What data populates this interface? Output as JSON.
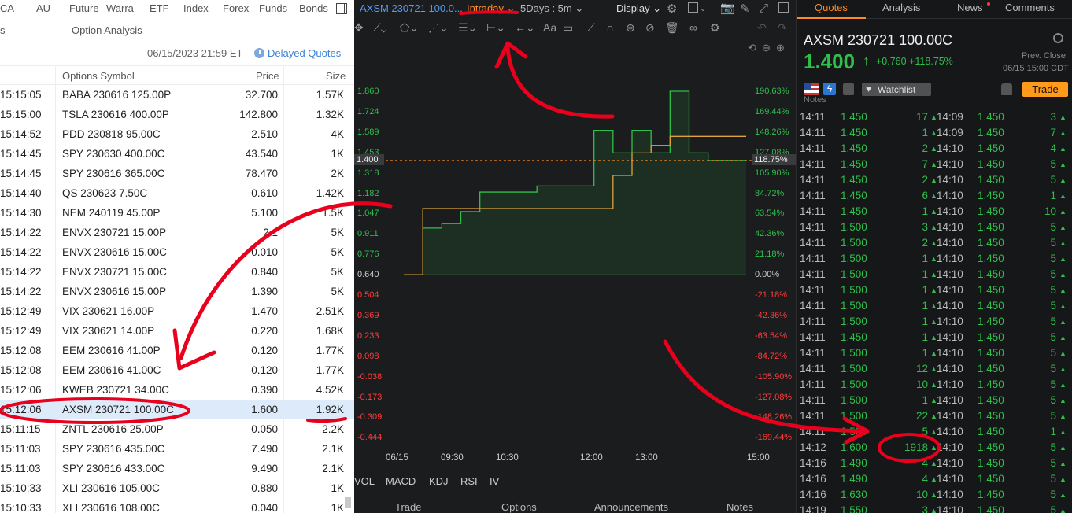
{
  "left": {
    "market_tabs": [
      "CA",
      "AU",
      "Future",
      "Warra",
      "ETF",
      "Index",
      "Forex",
      "Funds",
      "Bonds"
    ],
    "subtabs": [
      "s",
      "Option Analysis"
    ],
    "datetime": "06/15/2023 21:59 ET",
    "delayed": "Delayed Quotes",
    "columns": {
      "symbol": "Options Symbol",
      "price": "Price",
      "size": "Size"
    },
    "rows": [
      {
        "time": "15:15:05",
        "symbol": "BABA 230616 125.00P",
        "price": "32.700",
        "size": "1.57K"
      },
      {
        "time": "15:15:00",
        "symbol": "TSLA 230616 400.00P",
        "price": "142.800",
        "size": "1.32K"
      },
      {
        "time": "15:14:52",
        "symbol": "PDD 230818 95.00C",
        "price": "2.510",
        "size": "4K"
      },
      {
        "time": "15:14:45",
        "symbol": "SPY 230630 400.00C",
        "price": "43.540",
        "size": "1K"
      },
      {
        "time": "15:14:45",
        "symbol": "SPY 230616 365.00C",
        "price": "78.470",
        "size": "2K"
      },
      {
        "time": "15:14:40",
        "symbol": "QS 230623 7.50C",
        "price": "0.610",
        "size": "1.42K"
      },
      {
        "time": "15:14:30",
        "symbol": "NEM 240119 45.00P",
        "price": "5.100",
        "size": "1.5K"
      },
      {
        "time": "15:14:22",
        "symbol": "ENVX 230721 15.00P",
        "price": "2.1",
        "size": "5K"
      },
      {
        "time": "15:14:22",
        "symbol": "ENVX 230616 15.00C",
        "price": "0.010",
        "size": "5K"
      },
      {
        "time": "15:14:22",
        "symbol": "ENVX 230721 15.00C",
        "price": "0.840",
        "size": "5K"
      },
      {
        "time": "15:14:22",
        "symbol": "ENVX 230616 15.00P",
        "price": "1.390",
        "size": "5K"
      },
      {
        "time": "15:12:49",
        "symbol": "VIX 230621 16.00P",
        "price": "1.470",
        "size": "2.51K"
      },
      {
        "time": "15:12:49",
        "symbol": "VIX 230621 14.00P",
        "price": "0.220",
        "size": "1.68K"
      },
      {
        "time": "15:12:08",
        "symbol": "EEM 230616 41.00P",
        "price": "0.120",
        "size": "1.77K"
      },
      {
        "time": "15:12:08",
        "symbol": "EEM 230616 41.00C",
        "price": "0.120",
        "size": "1.77K"
      },
      {
        "time": "15:12:06",
        "symbol": "KWEB 230721 34.00C",
        "price": "0.390",
        "size": "4.52K"
      },
      {
        "time": "15:12:06",
        "symbol": "AXSM 230721 100.00C",
        "price": "1.600",
        "size": "1.92K"
      },
      {
        "time": "15:11:15",
        "symbol": "ZNTL 230616 25.00P",
        "price": "0.050",
        "size": "2.2K"
      },
      {
        "time": "15:11:03",
        "symbol": "SPY 230616 435.00C",
        "price": "7.490",
        "size": "2.1K"
      },
      {
        "time": "15:11:03",
        "symbol": "SPY 230616 433.00C",
        "price": "9.490",
        "size": "2.1K"
      },
      {
        "time": "15:10:33",
        "symbol": "XLI 230616 105.00C",
        "price": "0.880",
        "size": "1K"
      },
      {
        "time": "15:10:33",
        "symbol": "XLI 230616 108.00C",
        "price": "0.040",
        "size": "1K"
      }
    ],
    "selected_index": 16
  },
  "mid": {
    "title": "AXSM 230721 100.0...",
    "period": "Intraday",
    "interval": "5Days : 5m",
    "display": "Display",
    "indicators": [
      "VOL",
      "MACD",
      "KDJ",
      "RSI",
      "IV"
    ],
    "bottom_tabs": [
      "Trade",
      "Options",
      "Announcements",
      "Notes"
    ],
    "price_axis": [
      "1.860",
      "1.724",
      "1.589",
      "1.453",
      "1.318",
      "1.182",
      "1.047",
      "0.911",
      "0.776",
      "0.640",
      "0.504",
      "0.369",
      "0.233",
      "0.098",
      "-0.038",
      "-0.173",
      "-0.309",
      "-0.444"
    ],
    "pct_axis": [
      "190.63%",
      "169.44%",
      "148.26%",
      "127.08%",
      "105.90%",
      "84.72%",
      "63.54%",
      "42.36%",
      "21.18%",
      "0.00%",
      "-21.18%",
      "-42.36%",
      "-63.54%",
      "-84.72%",
      "-105.90%",
      "-127.08%",
      "-148.26%",
      "-169.44%"
    ],
    "current_price_tag": "1.400",
    "current_pct_tag": "118.75%",
    "time_labels": [
      "06/15",
      "09:30",
      "10:30",
      "12:00",
      "13:00",
      "15:00"
    ]
  },
  "chart_data": {
    "type": "line",
    "title": "",
    "xlabel": "",
    "ylabel": "",
    "x": [
      "06/15 09:30",
      "09:40",
      "09:50",
      "10:05",
      "10:30",
      "11:10",
      "11:45",
      "11:50",
      "12:30",
      "13:10",
      "14:05",
      "14:10",
      "14:12",
      "14:16",
      "14:20",
      "14:30",
      "14:40",
      "14:50",
      "15:00"
    ],
    "series": [
      {
        "values": [
          0.64,
          0.95,
          0.98,
          1.06,
          1.19,
          1.19,
          1.19,
          1.23,
          1.23,
          1.23,
          1.6,
          1.45,
          1.6,
          1.45,
          1.86,
          1.45,
          1.4,
          1.4,
          1.4
        ]
      },
      {
        "values": [
          0.64,
          1.08,
          1.08,
          1.08,
          1.08,
          1.08,
          1.08,
          1.08,
          1.08,
          1.08,
          1.08,
          1.3,
          1.45,
          1.5,
          1.56,
          1.56,
          1.56,
          1.56,
          1.56
        ]
      }
    ],
    "ylim": [
      -0.444,
      1.86
    ],
    "reference_price": 0.64,
    "grid": false
  },
  "right": {
    "tabs": [
      "Quotes",
      "Analysis",
      "News",
      "Comments"
    ],
    "symbol": "AXSM 230721 100.00C",
    "price": "1.400",
    "arrow": "↑",
    "change": "+0.760 +118.75%",
    "prev_label": "Prev.  Close",
    "prev_datetime": "06/15 15:00 CDT",
    "watchlist": "Watchlist",
    "trade": "Trade",
    "notes_label": "Notes",
    "ticks": [
      [
        "14:11",
        "1.450",
        "17",
        "14:09",
        "1.450",
        "3"
      ],
      [
        "14:11",
        "1.450",
        "1",
        "14:09",
        "1.450",
        "7"
      ],
      [
        "14:11",
        "1.450",
        "2",
        "14:10",
        "1.450",
        "4"
      ],
      [
        "14:11",
        "1.450",
        "7",
        "14:10",
        "1.450",
        "5"
      ],
      [
        "14:11",
        "1.450",
        "2",
        "14:10",
        "1.450",
        "5"
      ],
      [
        "14:11",
        "1.450",
        "6",
        "14:10",
        "1.450",
        "1"
      ],
      [
        "14:11",
        "1.450",
        "1",
        "14:10",
        "1.450",
        "10"
      ],
      [
        "14:11",
        "1.500",
        "3",
        "14:10",
        "1.450",
        "5"
      ],
      [
        "14:11",
        "1.500",
        "2",
        "14:10",
        "1.450",
        "5"
      ],
      [
        "14:11",
        "1.500",
        "1",
        "14:10",
        "1.450",
        "5"
      ],
      [
        "14:11",
        "1.500",
        "1",
        "14:10",
        "1.450",
        "5"
      ],
      [
        "14:11",
        "1.500",
        "1",
        "14:10",
        "1.450",
        "5"
      ],
      [
        "14:11",
        "1.500",
        "1",
        "14:10",
        "1.450",
        "5"
      ],
      [
        "14:11",
        "1.500",
        "1",
        "14:10",
        "1.450",
        "5"
      ],
      [
        "14:11",
        "1.450",
        "1",
        "14:10",
        "1.450",
        "5"
      ],
      [
        "14:11",
        "1.500",
        "1",
        "14:10",
        "1.450",
        "5"
      ],
      [
        "14:11",
        "1.500",
        "12",
        "14:10",
        "1.450",
        "5"
      ],
      [
        "14:11",
        "1.500",
        "10",
        "14:10",
        "1.450",
        "5"
      ],
      [
        "14:11",
        "1.500",
        "1",
        "14:10",
        "1.450",
        "5"
      ],
      [
        "14:11",
        "1.500",
        "22",
        "14:10",
        "1.450",
        "5"
      ],
      [
        "14:11",
        "1.500",
        "5",
        "14:10",
        "1.450",
        "1"
      ],
      [
        "14:12",
        "1.600",
        "1918",
        "14:10",
        "1.450",
        "5"
      ],
      [
        "14:16",
        "1.490",
        "4",
        "14:10",
        "1.450",
        "5"
      ],
      [
        "14:16",
        "1.490",
        "4",
        "14:10",
        "1.450",
        "5"
      ],
      [
        "14:16",
        "1.630",
        "10",
        "14:10",
        "1.450",
        "5"
      ],
      [
        "14:19",
        "1.550",
        "3",
        "14:10",
        "1.450",
        "5"
      ]
    ]
  },
  "colors": {
    "up": "#2fbf4a",
    "down": "#ff3b3b",
    "accent": "#ff8a1f",
    "link": "#3b82d8",
    "annotation": "#e8001c",
    "selection": "#ddeafa"
  }
}
